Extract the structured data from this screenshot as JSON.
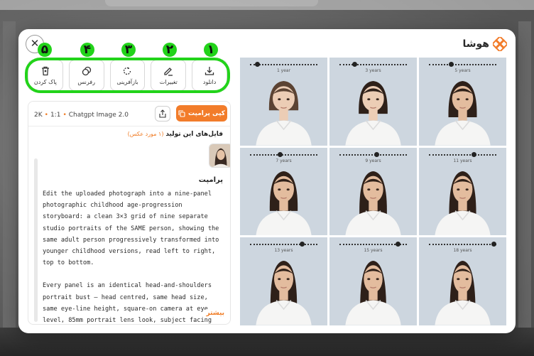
{
  "app": {
    "brand": "هوشا"
  },
  "toolbar": {
    "items": [
      {
        "id": "download",
        "label": "دانلود",
        "icon": "download-icon",
        "annotation": "۱"
      },
      {
        "id": "edit",
        "label": "تغییرات",
        "icon": "pencil-icon",
        "annotation": "۲"
      },
      {
        "id": "regenerate",
        "label": "بازآفرینی",
        "icon": "refresh-icon",
        "annotation": "۳"
      },
      {
        "id": "reference",
        "label": "رفرنس",
        "icon": "layers-icon",
        "annotation": "۴"
      },
      {
        "id": "delete",
        "label": "پاک کردن",
        "icon": "trash-icon",
        "annotation": "۵"
      }
    ]
  },
  "info": {
    "resolution": "2K",
    "ratio": "1:1",
    "model": "Chatgpt Image 2.0",
    "copy_label": "کپی پرامپت",
    "files_label": "فایل‌های این تولید",
    "files_count": "(۱ مورد عکس)",
    "prompt_label": "پرامپت",
    "prompt_paragraphs": [
      "Edit the uploaded photograph into a nine-panel photographic childhood age-progression storyboard: a clean 3×3 grid of nine separate studio portraits of the SAME person, showing the same adult person progressively transformed into younger childhood versions, read left to right, top to bottom.",
      "Every panel is an identical head-and-shoulders portrait bust — head centred, same head size, same eye-line height, square-on camera at eye level, 85mm portrait lens look, subject facing the lens with a calm neutral closed-lip expression. Flat light grayish-blue seamless back..."
    ],
    "more_label": "بیشتر"
  },
  "colors": {
    "accent": "#f27c2a",
    "annotation": "#22d31a",
    "panel_bg": "#cdd6df"
  },
  "grid": {
    "panels": [
      {
        "age": "1 year",
        "progress": 0.08
      },
      {
        "age": "3 years",
        "progress": 0.2
      },
      {
        "age": "5 years",
        "progress": 0.32
      },
      {
        "age": "7 years",
        "progress": 0.44
      },
      {
        "age": "9 years",
        "progress": 0.56
      },
      {
        "age": "11 years",
        "progress": 0.68
      },
      {
        "age": "13 years",
        "progress": 0.8
      },
      {
        "age": "15 years",
        "progress": 0.9
      },
      {
        "age": "18 years",
        "progress": 1.0
      }
    ]
  }
}
